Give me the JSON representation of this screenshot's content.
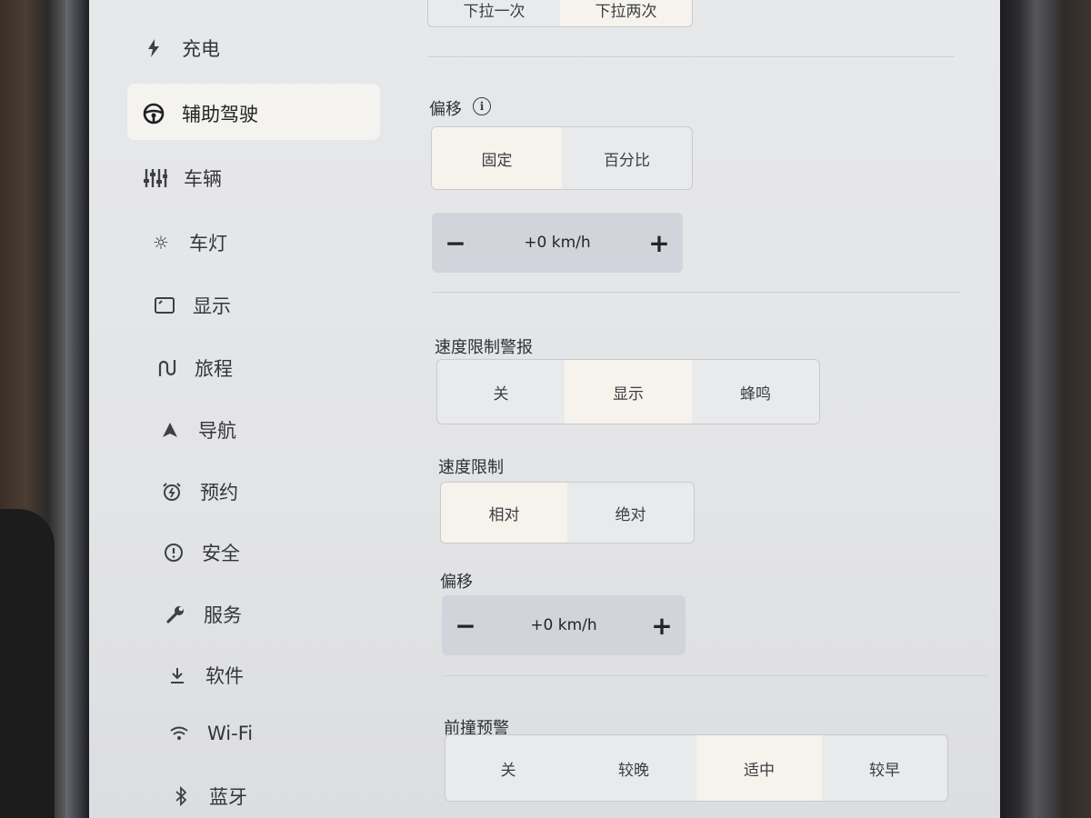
{
  "sidebar": {
    "items": [
      {
        "label": "充电",
        "icon": "lightning-icon"
      },
      {
        "label": "辅助驾驶",
        "icon": "steering-wheel-icon",
        "active": true
      },
      {
        "label": "车辆",
        "icon": "sliders-icon"
      },
      {
        "label": "车灯",
        "icon": "sun-icon"
      },
      {
        "label": "显示",
        "icon": "display-icon"
      },
      {
        "label": "旅程",
        "icon": "trip-icon"
      },
      {
        "label": "导航",
        "icon": "navigation-arrow-icon"
      },
      {
        "label": "预约",
        "icon": "alarm-clock-icon"
      },
      {
        "label": "安全",
        "icon": "alert-circle-icon"
      },
      {
        "label": "服务",
        "icon": "wrench-icon"
      },
      {
        "label": "软件",
        "icon": "download-icon"
      },
      {
        "label": "Wi-Fi",
        "icon": "wifi-icon"
      },
      {
        "label": "蓝牙",
        "icon": "bluetooth-icon"
      }
    ]
  },
  "main": {
    "top_segment": {
      "options": [
        "下拉一次",
        "下拉两次"
      ],
      "selected": 1
    },
    "offset_1": {
      "label": "偏移",
      "mode": {
        "options": [
          "固定",
          "百分比"
        ],
        "selected": 0
      },
      "stepper": {
        "minus": "−",
        "value": "+0 km/h",
        "plus": "+"
      }
    },
    "speed_limit_warning": {
      "label": "速度限制警报",
      "options": [
        "关",
        "显示",
        "蜂鸣"
      ],
      "selected": 1
    },
    "speed_limit": {
      "label": "速度限制",
      "options": [
        "相对",
        "绝对"
      ],
      "selected": 0
    },
    "offset_2": {
      "label": "偏移",
      "stepper": {
        "minus": "−",
        "value": "+0 km/h",
        "plus": "+"
      }
    },
    "forward_collision_warning": {
      "label": "前撞预警",
      "options": [
        "关",
        "较晚",
        "适中",
        "较早"
      ],
      "selected": 2
    }
  },
  "colors": {
    "screen_bg": "#e5e6e8",
    "selected_bg": "#f5f3ec",
    "stepper_bg": "#d2d4dc"
  }
}
